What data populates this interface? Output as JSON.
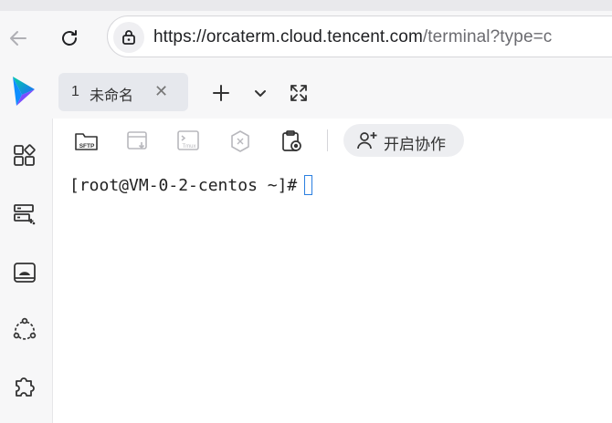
{
  "browser": {
    "url_host": "https://orcaterm.cloud.tencent.com",
    "url_rest": "/terminal?type=c"
  },
  "app": {
    "session_tab": {
      "number": "1",
      "name": "未命名",
      "close": "✕"
    }
  },
  "toolbar": {
    "sftp_label": "SFTP",
    "tmux_label": "Tmux",
    "collab_label": "开启协作"
  },
  "terminal": {
    "prompt": "[root@VM-0-2-centos ~]#"
  },
  "colors": {
    "accent": "#2a7fe0",
    "logo_blue": "#1f6bff",
    "logo_green": "#00c48c"
  }
}
